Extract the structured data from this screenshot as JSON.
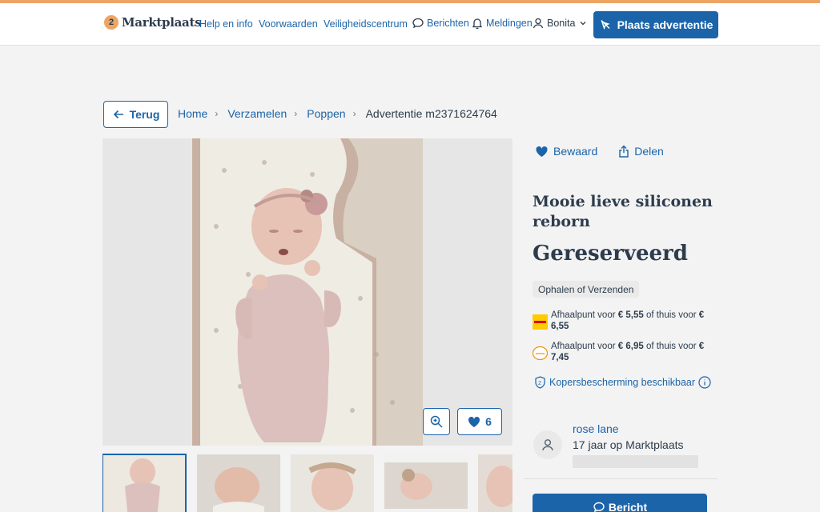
{
  "header": {
    "logo_text": "Marktplaats",
    "links": [
      "Help en info",
      "Voorwaarden",
      "Veiligheidscentrum"
    ],
    "messages": "Berichten",
    "notifications": "Meldingen",
    "user": "Bonita",
    "cta": "Plaats advertentie"
  },
  "nav": {
    "back": "Terug",
    "breadcrumb": [
      "Home",
      "Verzamelen",
      "Poppen"
    ],
    "current": "Advertentie m2371624764"
  },
  "gallery": {
    "favorite_count": "6",
    "thumb_count": 5
  },
  "listing": {
    "save": "Bewaard",
    "share": "Delen",
    "title": "Mooie lieve siliconen reborn",
    "price": "Gereserveerd",
    "delivery": "Ophalen of Verzenden",
    "shipping": [
      {
        "carrier": "dhl-icon",
        "text_a": "Afhaalpunt voor ",
        "price_a": "€ 5,55",
        "text_b": " of thuis voor ",
        "price_b": "€ 6,55"
      },
      {
        "carrier": "postnl-icon",
        "text_a": "Afhaalpunt voor ",
        "price_a": "€ 6,95",
        "text_b": " of thuis voor ",
        "price_b": "€ 7,45"
      }
    ],
    "protection": "Kopersbescherming beschikbaar"
  },
  "seller": {
    "name": "rose lane",
    "since": "17 jaar op Marktplaats"
  },
  "message_button": "Bericht",
  "colors": {
    "accent": "#1b64a9",
    "brand": "#eda566",
    "text": "#2d3c4d"
  }
}
